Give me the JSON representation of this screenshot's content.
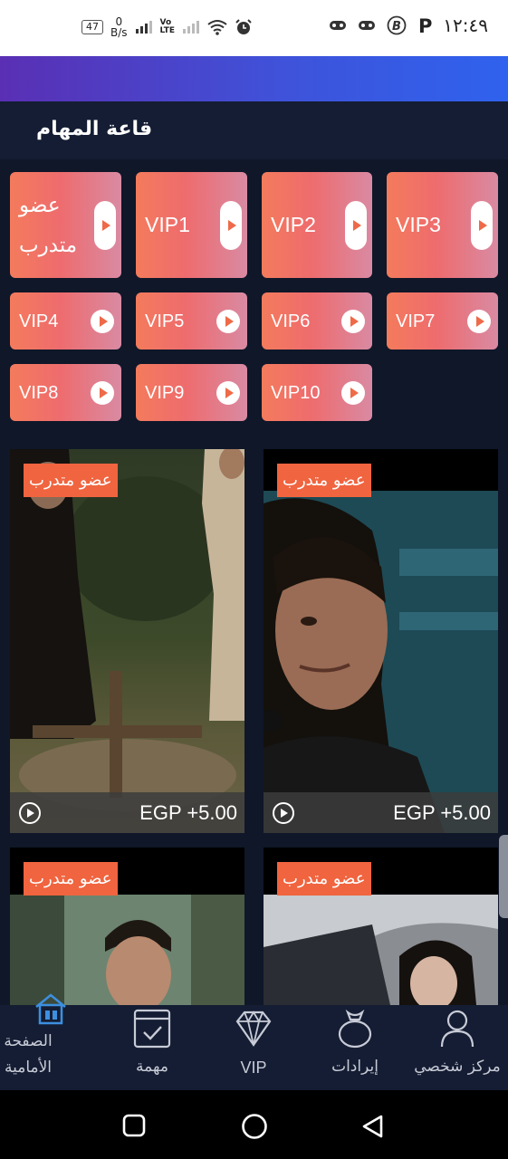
{
  "status_bar": {
    "battery": "47",
    "net_speed_value": "0",
    "net_speed_unit": "B/s",
    "volte": "Vo\nLTE",
    "time": "١٢:٤٩"
  },
  "hall": {
    "title": "قاعة المهام"
  },
  "tasks": [
    {
      "label": "عضو\nمتدرب"
    },
    {
      "label": "VIP1"
    },
    {
      "label": "VIP2"
    },
    {
      "label": "VIP3"
    },
    {
      "label": "VIP4"
    },
    {
      "label": "VIP5"
    },
    {
      "label": "VIP6"
    },
    {
      "label": "VIP7"
    },
    {
      "label": "VIP8"
    },
    {
      "label": "VIP9"
    },
    {
      "label": "VIP10"
    }
  ],
  "cards": [
    {
      "badge": "عضو متدرب",
      "price": "EGP +5.00"
    },
    {
      "badge": "عضو متدرب",
      "price": "EGP +5.00"
    },
    {
      "badge": "عضو متدرب"
    },
    {
      "badge": "عضو متدرب"
    }
  ],
  "bottom_nav": [
    {
      "label": "الصفحة\nالأمامية",
      "icon": "home-icon"
    },
    {
      "label": "مهمة",
      "icon": "task-icon"
    },
    {
      "label": "VIP",
      "icon": "diamond-icon"
    },
    {
      "label": "إيرادات",
      "icon": "money-bag-icon"
    },
    {
      "label": "مركز شخصي",
      "icon": "person-icon"
    }
  ],
  "colors": {
    "background": "#0f1729",
    "accent_orange": "#f0643f",
    "active_nav": "#3d8fe0",
    "gradient_start": "#5a2fb4",
    "gradient_end": "#2f62ee"
  }
}
